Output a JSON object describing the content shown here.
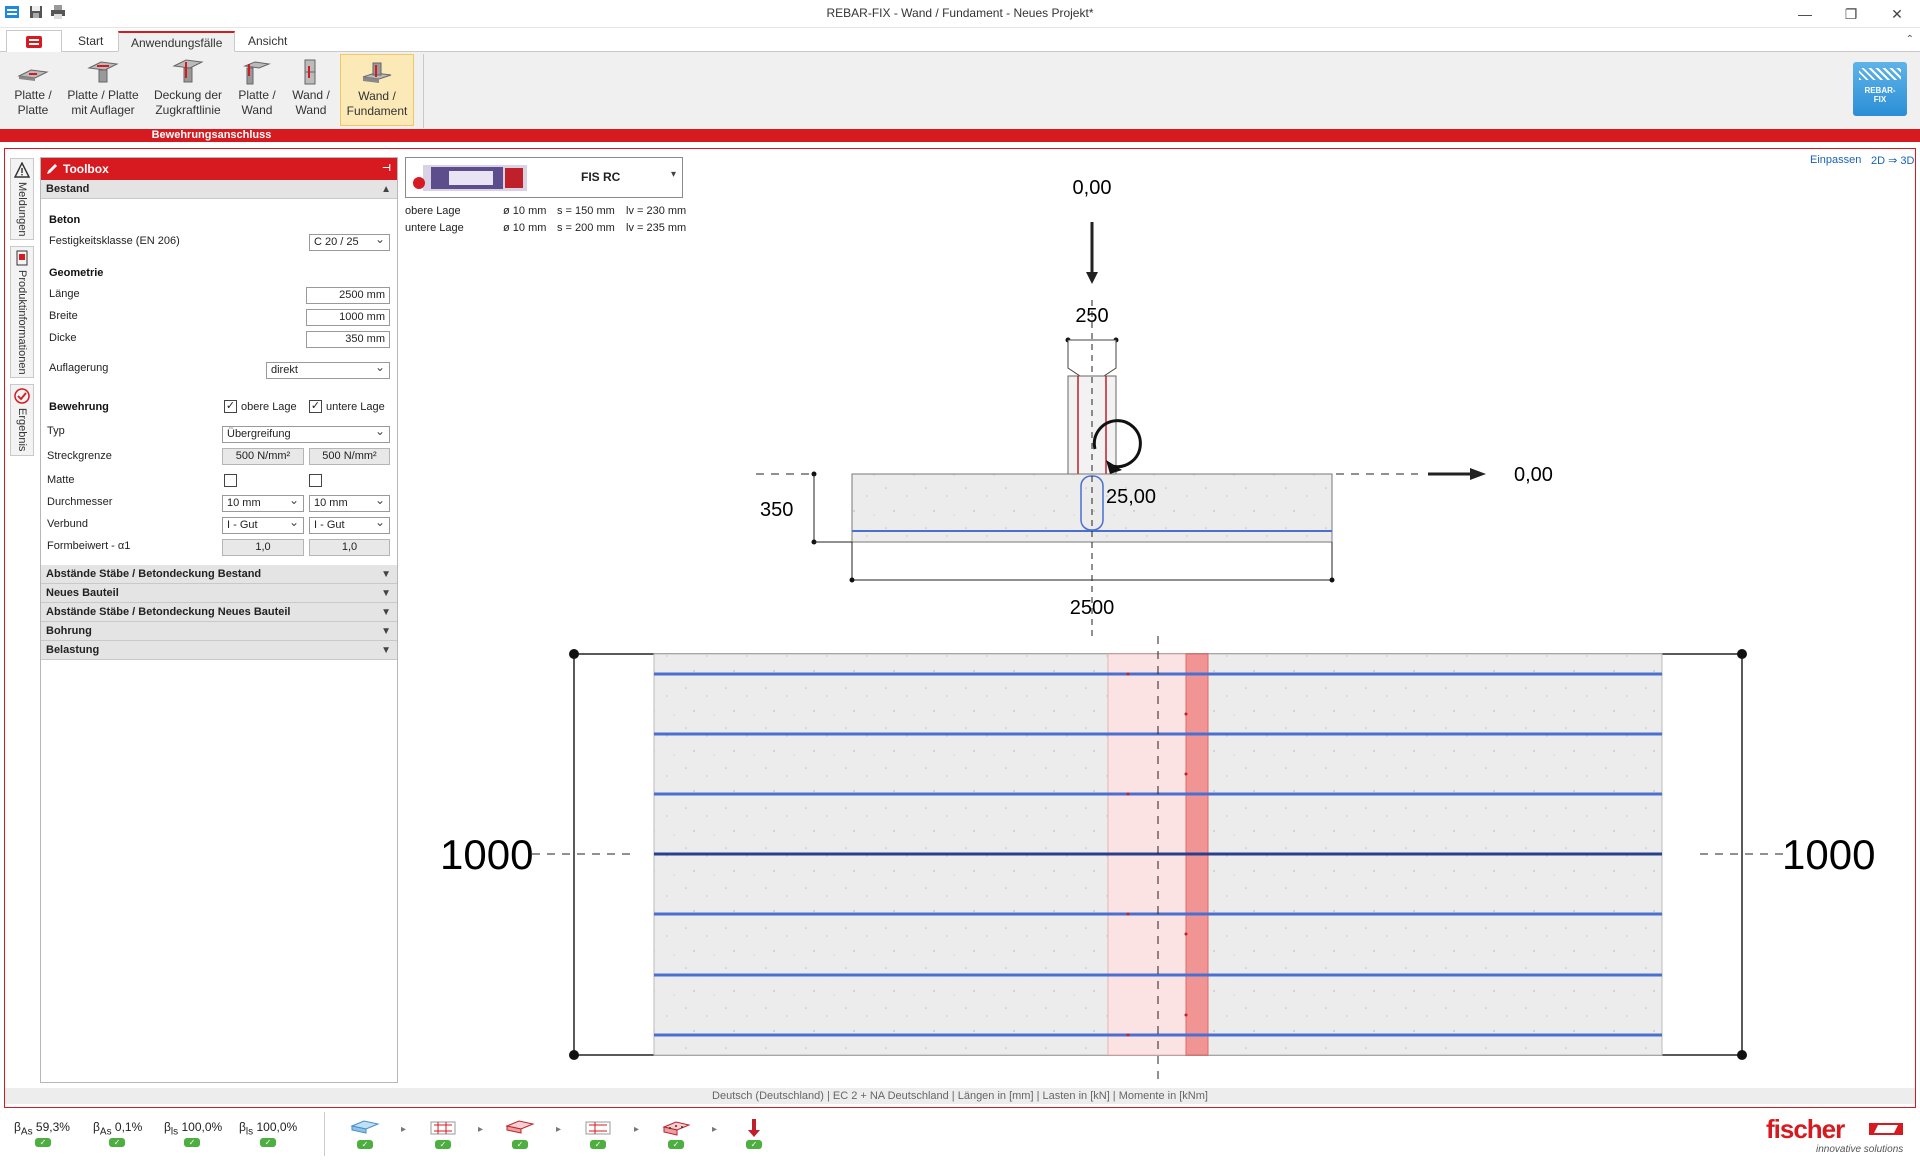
{
  "window": {
    "title": "REBAR-FIX - Wand / Fundament - Neues Projekt*"
  },
  "tabs": [
    {
      "label": "Start"
    },
    {
      "label": "Anwendungsfälle"
    },
    {
      "label": "Ansicht"
    }
  ],
  "ribbon": {
    "buttons": [
      {
        "label1": "Platte /",
        "label2": "Platte"
      },
      {
        "label1": "Platte / Platte",
        "label2": "mit Auflager"
      },
      {
        "label1": "Deckung der",
        "label2": "Zugkraftlinie"
      },
      {
        "label1": "Platte /",
        "label2": "Wand"
      },
      {
        "label1": "Wand /",
        "label2": "Wand"
      },
      {
        "label1": "Wand /",
        "label2": "Fundament"
      }
    ],
    "group_label": "Bewehrungsanschluss",
    "logo_text1": "REBAR-",
    "logo_text2": "FIX"
  },
  "side_tabs": [
    {
      "label": "Meldungen"
    },
    {
      "label": "Produktinformationen"
    },
    {
      "label": "Ergebnis"
    }
  ],
  "toolbox": {
    "title": "Toolbox",
    "sections": {
      "bestand": "Bestand",
      "abstaende_bestand": "Abstände Stäbe / Betondeckung Bestand",
      "neues_bauteil": "Neues Bauteil",
      "abstaende_neu": "Abstände Stäbe / Betondeckung Neues Bauteil",
      "bohrung": "Bohrung",
      "belastung": "Belastung"
    },
    "beton": {
      "heading": "Beton",
      "festigkeit_label": "Festigkeitsklasse (EN 206)",
      "festigkeit_value": "C 20 / 25"
    },
    "geometrie": {
      "heading": "Geometrie",
      "laenge_label": "Länge",
      "laenge_value": "2500 mm",
      "breite_label": "Breite",
      "breite_value": "1000 mm",
      "dicke_label": "Dicke",
      "dicke_value": "350 mm",
      "auflagerung_label": "Auflagerung",
      "auflagerung_value": "direkt"
    },
    "bewehrung": {
      "heading": "Bewehrung",
      "obere_lage": "obere Lage",
      "untere_lage": "untere Lage",
      "typ_label": "Typ",
      "typ_value": "Übergreifung",
      "streck_label": "Streckgrenze",
      "streck_oben": "500 N/mm²",
      "streck_unten": "500 N/mm²",
      "matte_label": "Matte",
      "durch_label": "Durchmesser",
      "durch_oben": "10 mm",
      "durch_unten": "10 mm",
      "verbund_label": "Verbund",
      "verbund_oben": "I - Gut",
      "verbund_unten": "I - Gut",
      "form_label": "Formbeiwert - α1",
      "form_oben": "1,0",
      "form_unten": "1,0"
    }
  },
  "product": {
    "name": "FIS RC",
    "rows": [
      {
        "layer": "obere Lage",
        "d": "ø 10 mm",
        "s": "s = 150 mm",
        "lv": "lv = 230 mm"
      },
      {
        "layer": "untere Lage",
        "d": "ø 10 mm",
        "s": "s = 200 mm",
        "lv": "lv = 235 mm"
      }
    ]
  },
  "view": {
    "fit": "Einpassen",
    "mode": "2D ⇒ 3D"
  },
  "drawing": {
    "load_top": "0,00",
    "wall_width": "250",
    "load_right": "0,00",
    "moment": "25,00",
    "thickness": "350",
    "length": "2500",
    "width_left": "1000",
    "width_right": "1000"
  },
  "status": "Deutsch (Deutschland) | EC 2 + NA Deutschland | Längen in [mm] | Lasten in [kN] | Momente in [kNm]",
  "results": [
    {
      "sym": "β",
      "sub": "As",
      "val": "59,3%"
    },
    {
      "sym": "β",
      "sub": "As",
      "val": "0,1%"
    },
    {
      "sym": "β",
      "sub": "ls",
      "val": "100,0%"
    },
    {
      "sym": "β",
      "sub": "ls",
      "val": "100,0%"
    }
  ],
  "brand": {
    "name": "fischer",
    "tagline": "innovative solutions"
  },
  "colors": {
    "accent": "#d71920",
    "rebar_blue": "#4a6fd0",
    "ok_green": "#4caf3f"
  }
}
